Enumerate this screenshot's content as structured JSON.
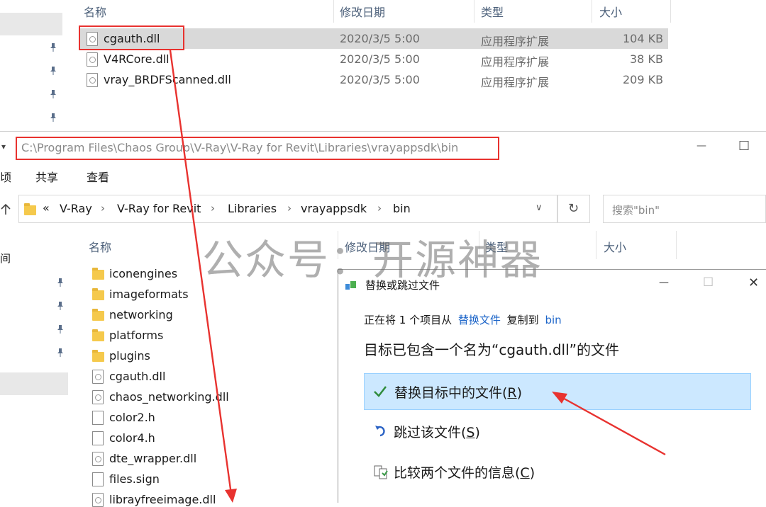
{
  "top_explorer": {
    "columns": [
      "名称",
      "修改日期",
      "类型",
      "大小"
    ],
    "files": [
      {
        "name": "cgauth.dll",
        "date": "2020/3/5 5:00",
        "type": "应用程序扩展",
        "size": "104 KB"
      },
      {
        "name": "V4RCore.dll",
        "date": "2020/3/5 5:00",
        "type": "应用程序扩展",
        "size": "38 KB"
      },
      {
        "name": "vray_BRDFScanned.dll",
        "date": "2020/3/5 5:00",
        "type": "应用程序扩展",
        "size": "209 KB"
      }
    ]
  },
  "window": {
    "title_path": "C:\\Program Files\\Chaos Group\\V-Ray\\V-Ray for Revit\\Libraries\\vrayappsdk\\bin",
    "menu_fragment": "顷",
    "menu_share": "共享",
    "menu_view": "查看",
    "minimize_glyph": "—",
    "maximize_glyph": "☐"
  },
  "address_bar": {
    "overflow": "«",
    "crumbs": [
      "V-Ray",
      "V-Ray for Revit",
      "Libraries",
      "vrayappsdk",
      "bin"
    ],
    "search_placeholder": "搜索\"bin\""
  },
  "bottom_explorer": {
    "columns": [
      "名称",
      "修改日期",
      "类型",
      "大小"
    ],
    "left_fragment": "间",
    "items": [
      {
        "name": "iconengines",
        "kind": "folder"
      },
      {
        "name": "imageformats",
        "kind": "folder"
      },
      {
        "name": "networking",
        "kind": "folder"
      },
      {
        "name": "platforms",
        "kind": "folder"
      },
      {
        "name": "plugins",
        "kind": "folder"
      },
      {
        "name": "cgauth.dll",
        "kind": "dll"
      },
      {
        "name": "chaos_networking.dll",
        "kind": "dll"
      },
      {
        "name": "color2.h",
        "kind": "file"
      },
      {
        "name": "color4.h",
        "kind": "file"
      },
      {
        "name": "dte_wrapper.dll",
        "kind": "dll"
      },
      {
        "name": "files.sign",
        "kind": "file"
      },
      {
        "name": "librayfreeimage.dll",
        "kind": "dll"
      }
    ]
  },
  "watermark": "公众号：开源神器",
  "dialog": {
    "title": "替换或跳过文件",
    "minimize_glyph": "—",
    "maximize_glyph": "☐",
    "close_glyph": "✕",
    "copy_prefix": "正在将 1 个项目从",
    "copy_source": "替换文件",
    "copy_mid": "复制到",
    "copy_dest": "bin",
    "message": "目标已包含一个名为“cgauth.dll”的文件",
    "option_replace_text": "替换目标中的文件(",
    "option_replace_key": "R",
    "option_skip_text": "跳过该文件(",
    "option_skip_key": "S",
    "option_compare_text": "比较两个文件的信息(",
    "option_compare_key": "C",
    "close_paren": ")"
  },
  "colors": {
    "annotation_red": "#e8322f",
    "link_blue": "#1e66c9",
    "selection": "#cce8ff"
  }
}
